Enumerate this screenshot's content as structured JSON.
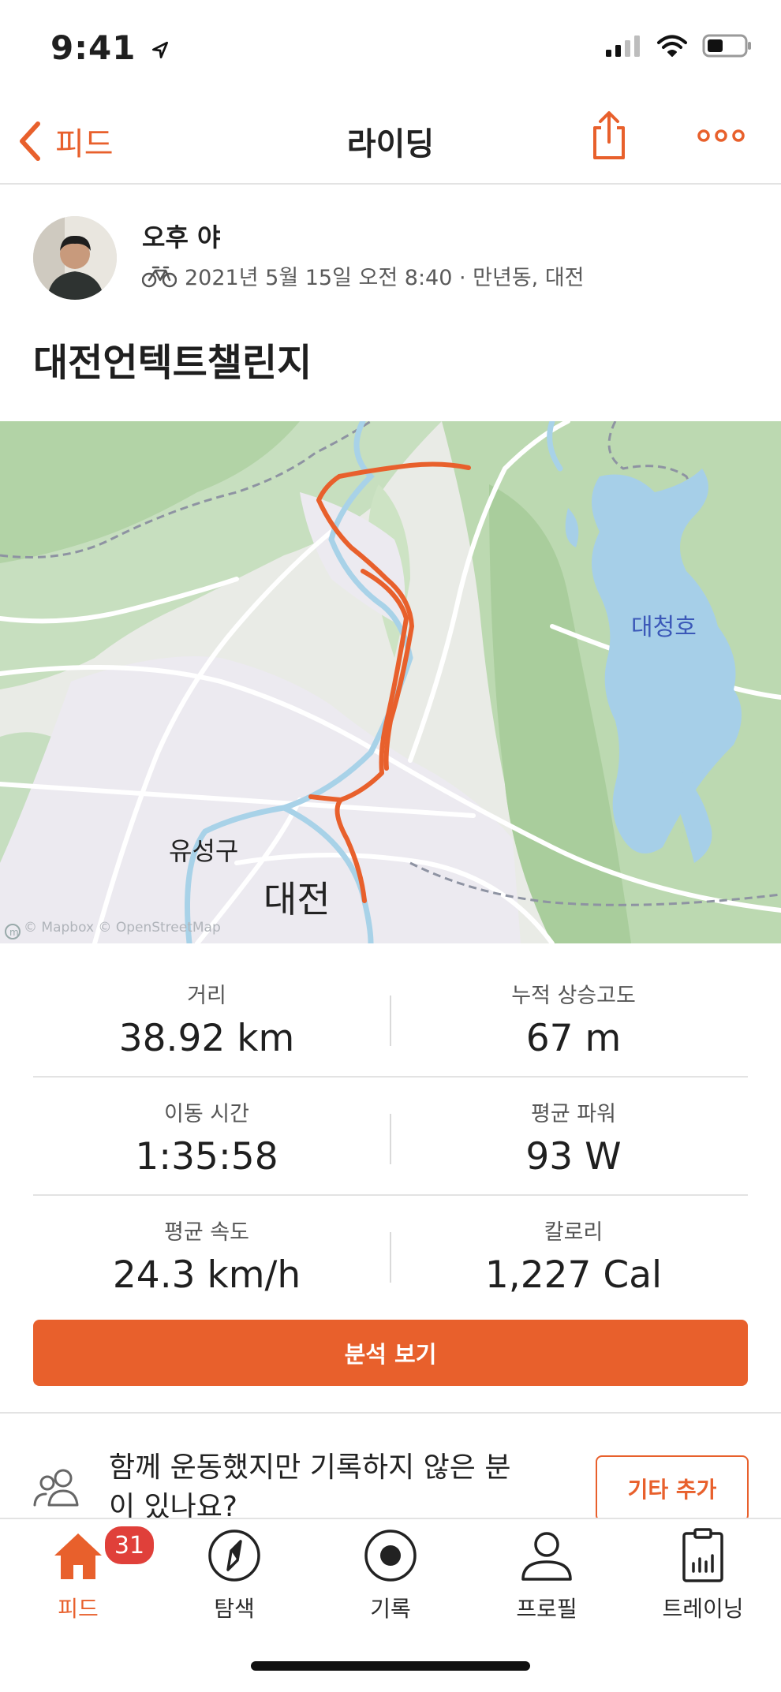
{
  "status": {
    "time": "9:41"
  },
  "nav": {
    "back_label": "피드",
    "title": "라이딩"
  },
  "activity": {
    "athlete_name": "오후 야",
    "meta": "2021년 5월 15일 오전 8:40 · 만년동, 대전",
    "title": "대전언텍트챌린지"
  },
  "map": {
    "labels": {
      "lake": "대청호",
      "district": "유성구",
      "city": "대전"
    },
    "attribution": "© Mapbox © OpenStreetMap",
    "route_color": "#e8602c"
  },
  "stats": [
    {
      "label": "거리",
      "value": "38.92 km"
    },
    {
      "label": "누적 상승고도",
      "value": "67 m"
    },
    {
      "label": "이동 시간",
      "value": "1:35:58"
    },
    {
      "label": "평균 파워",
      "value": "93 W"
    },
    {
      "label": "평균 속도",
      "value": "24.3 km/h"
    },
    {
      "label": "칼로리",
      "value": "1,227 Cal"
    }
  ],
  "analyze_button": "분석 보기",
  "group_prompt": {
    "text": "함께 운동했지만 기록하지 않은 분이 있나요?",
    "button": "기타 추가"
  },
  "tabs": [
    {
      "label": "피드",
      "icon": "home-icon",
      "badge": "31",
      "active": true
    },
    {
      "label": "탐색",
      "icon": "compass-icon"
    },
    {
      "label": "기록",
      "icon": "record-icon"
    },
    {
      "label": "프로필",
      "icon": "profile-icon"
    },
    {
      "label": "트레이닝",
      "icon": "training-icon"
    }
  ],
  "colors": {
    "accent": "#e8602c",
    "badge": "#e0403a"
  }
}
